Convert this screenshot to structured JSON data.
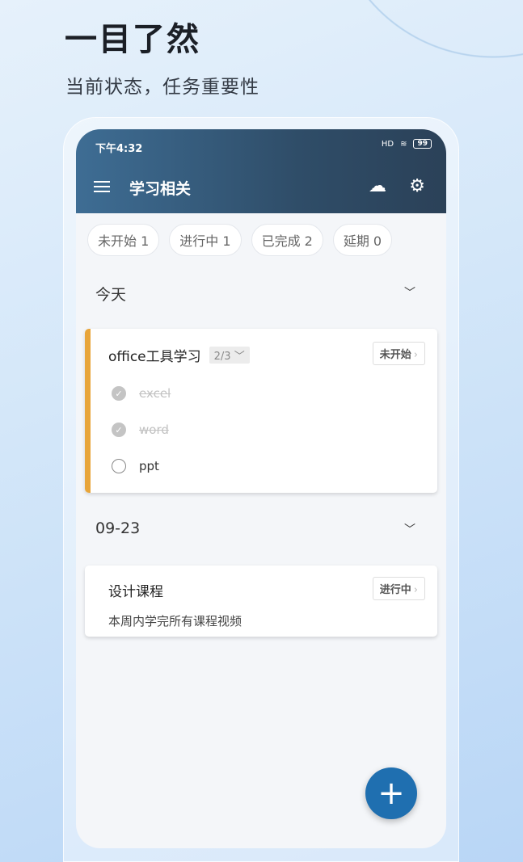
{
  "promo": {
    "title": "一目了然",
    "subtitle": "当前状态，任务重要性"
  },
  "status_bar": {
    "time": "下午4:32",
    "signal": "HD",
    "battery": "99"
  },
  "header": {
    "title": "学习相关",
    "sync_icon": "cloud-sync-icon",
    "settings_icon": "gear-icon"
  },
  "filters": [
    {
      "label": "未开始 1"
    },
    {
      "label": "进行中 1"
    },
    {
      "label": "已完成 2"
    },
    {
      "label": "延期 0"
    }
  ],
  "sections": [
    {
      "label": "今天",
      "tasks": [
        {
          "title": "office工具学习",
          "progress": "2/3",
          "status": "未开始",
          "accent": "#e8a53a",
          "subtasks": [
            {
              "label": "excel",
              "done": true
            },
            {
              "label": "word",
              "done": true
            },
            {
              "label": "ppt",
              "done": false
            }
          ]
        }
      ]
    },
    {
      "label": "09-23",
      "tasks": [
        {
          "title": "设计课程",
          "status": "进行中",
          "description": "本周内学完所有课程视频"
        }
      ]
    }
  ],
  "fab": {
    "label": "+"
  }
}
